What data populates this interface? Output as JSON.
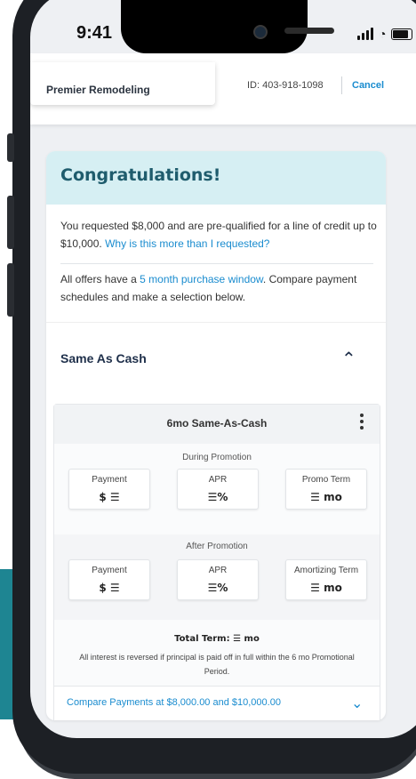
{
  "status_bar": {
    "time": "9:41"
  },
  "header": {
    "company": "Premier Remodeling",
    "id_text": "ID: 403-918-1098",
    "cancel_label": "Cancel"
  },
  "card": {
    "title": "Congratulations!",
    "intro_text": "You requested $8,000 and are pre-qualified for a line of credit up to $10,000.",
    "intro_link": "Why is this more than I requested?",
    "window_prefix": "All offers have a",
    "window_link": "5 month purchase window",
    "window_suffix": ". Compare payment schedules and make a selection below."
  },
  "accordion": {
    "title": "Same As Cash"
  },
  "offer": {
    "name": "6mo Same-As-Cash",
    "during_label": "During Promotion",
    "after_label": "After Promotion",
    "during": [
      {
        "label": "Payment",
        "value": "$ ☰"
      },
      {
        "label": "APR",
        "value": "☰%"
      },
      {
        "label": "Promo Term",
        "value": "☰ mo"
      }
    ],
    "after": [
      {
        "label": "Payment",
        "value": "$ ☰"
      },
      {
        "label": "APR",
        "value": "☰%"
      },
      {
        "label": "Amortizing Term",
        "value": "☰ mo"
      }
    ],
    "total_term": "Total Term: ☰ mo",
    "note": "All interest is reversed if principal is paid off in full within the 6 mo Promotional Period.",
    "compare": "Compare Payments at $8,000.00 and $10,000.00"
  },
  "colors": {
    "accent": "#1a8ccf",
    "title": "#1f5c6d",
    "card_head": "#d6eff3"
  }
}
